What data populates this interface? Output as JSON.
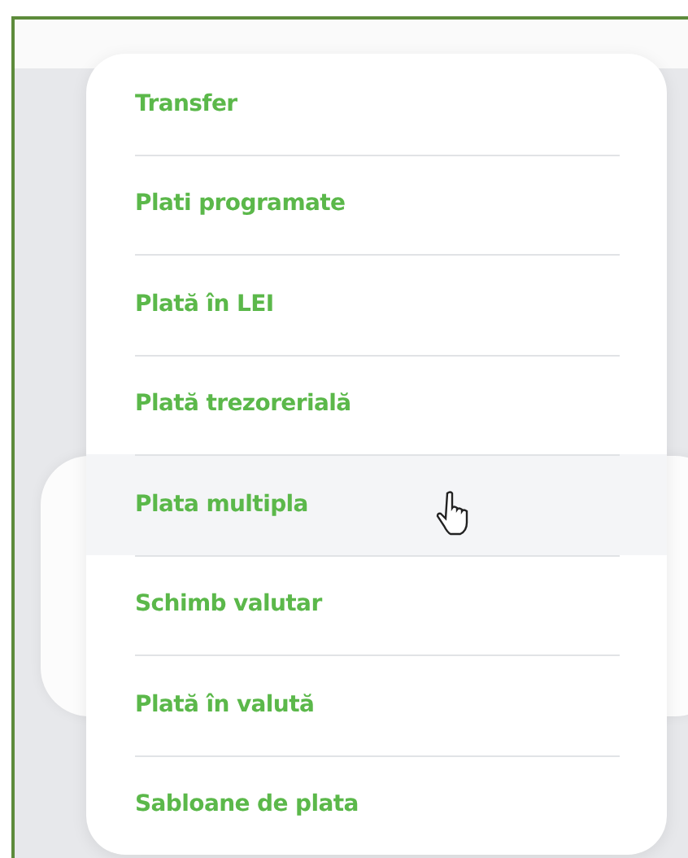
{
  "menu": {
    "items": [
      {
        "label": "Transfer",
        "hovered": false
      },
      {
        "label": "Plati programate",
        "hovered": false
      },
      {
        "label": "Plată în LEI",
        "hovered": false
      },
      {
        "label": "Plată trezorerială",
        "hovered": false
      },
      {
        "label": "Plata multipla",
        "hovered": true
      },
      {
        "label": "Schimb valutar",
        "hovered": false
      },
      {
        "label": "Plată în valută",
        "hovered": false
      },
      {
        "label": "Sabloane de plata",
        "hovered": false
      }
    ]
  }
}
